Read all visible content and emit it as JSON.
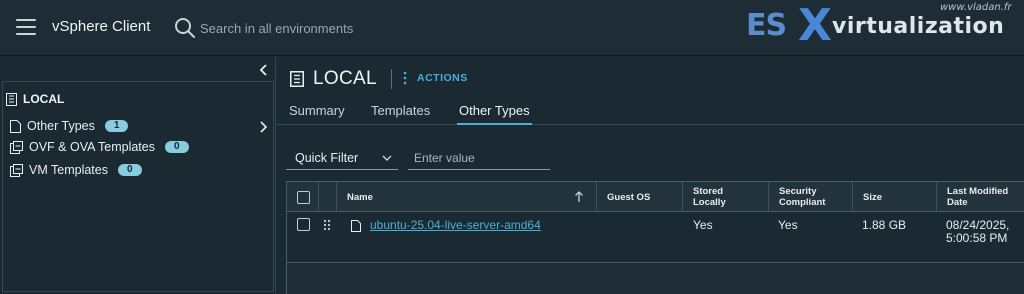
{
  "header": {
    "app_title": "vSphere Client",
    "search_placeholder": "Search in all environments"
  },
  "logo": {
    "esx": "ES",
    "x": "X",
    "virtualization": "virtualization",
    "site": "www.vladan.fr"
  },
  "sidebar": {
    "root_label": "LOCAL",
    "items": [
      {
        "label": "Other Types",
        "count": "1"
      },
      {
        "label": "OVF & OVA Templates",
        "count": "0"
      },
      {
        "label": "VM Templates",
        "count": "0"
      }
    ]
  },
  "main": {
    "title": "LOCAL",
    "actions_label": "ACTIONS",
    "tabs": [
      {
        "label": "Summary",
        "active": false
      },
      {
        "label": "Templates",
        "active": false
      },
      {
        "label": "Other Types",
        "active": true
      }
    ],
    "filter": {
      "select_label": "Quick Filter",
      "value_placeholder": "Enter value"
    },
    "grid": {
      "columns": [
        "Name",
        "Guest OS",
        "Stored Locally",
        "Security Compliant",
        "Size",
        "Last Modified Date"
      ],
      "rows": [
        {
          "name": "ubuntu-25.04-live-server-amd64",
          "guest_os": "",
          "stored_locally": "Yes",
          "security_compliant": "Yes",
          "size": "1.88 GB",
          "last_modified": "08/24/2025, 5:00:58 PM"
        }
      ]
    }
  },
  "colors": {
    "accent": "#49afd9",
    "badge": "#89cbdf",
    "background": "#1b2a32"
  }
}
